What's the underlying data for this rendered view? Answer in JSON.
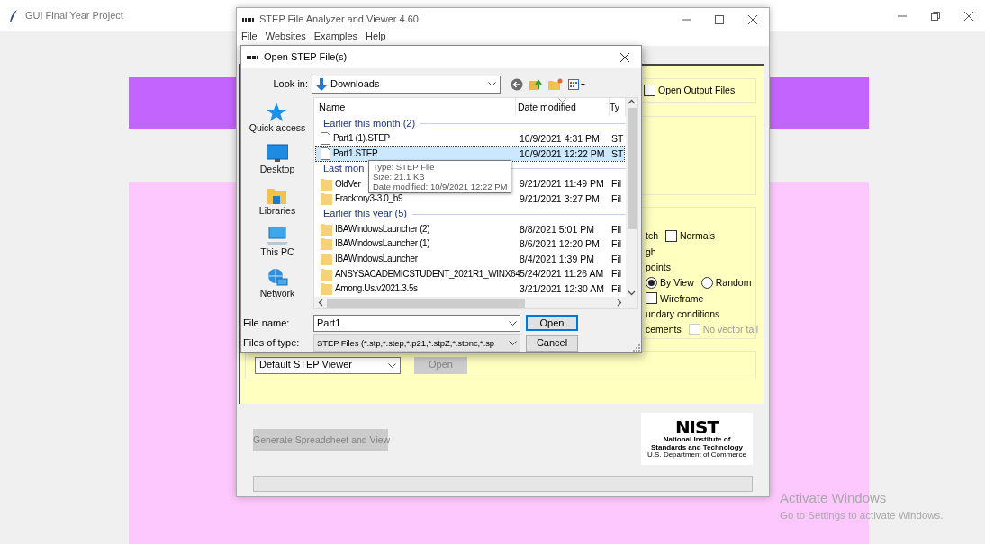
{
  "background_window": {
    "title": "GUI Final Year Project"
  },
  "step_window": {
    "title": "STEP File Analyzer and Viewer 4.60",
    "menu": [
      "File",
      "Websites",
      "Examples",
      "Help"
    ],
    "output_options": [
      {
        "kind": "checkbox",
        "label": "Open Output Files",
        "checked": false,
        "disabled": false
      }
    ],
    "view_options": [
      [
        {
          "kind": "text",
          "label": "tch"
        },
        {
          "kind": "checkbox",
          "label": "Normals",
          "checked": false,
          "disabled": false
        }
      ],
      [
        {
          "kind": "text",
          "label": "gh"
        }
      ],
      [
        {
          "kind": "text",
          "label": "points"
        }
      ],
      [
        {
          "kind": "radio",
          "label": "By View",
          "selected": true
        },
        {
          "kind": "radio",
          "label": "Random",
          "selected": false
        }
      ],
      [
        {
          "kind": "checkbox",
          "label": "Wireframe",
          "checked": false,
          "disabled": false
        }
      ],
      [
        {
          "kind": "text",
          "label": "undary conditions"
        }
      ],
      [
        {
          "kind": "text",
          "label": "cements"
        },
        {
          "kind": "checkbox",
          "label": "No vector tail",
          "checked": false,
          "disabled": true
        }
      ]
    ],
    "viewer": {
      "value": "Default STEP Viewer",
      "button": "Open",
      "disabled": true
    },
    "generate_button": {
      "label": "Generate Spreadsheet and View",
      "disabled": true
    },
    "logo": {
      "name": "NIST",
      "lines": [
        "National Institute of",
        "Standards and Technology",
        "U.S. Department of Commerce"
      ]
    },
    "progress": {
      "level": 0
    }
  },
  "dialog": {
    "title": "Open STEP File(s)",
    "look_in_label": "Look in:",
    "look_in": "Downloads",
    "places": [
      {
        "kind": "star",
        "label": "Quick access"
      },
      {
        "kind": "desktop",
        "label": "Desktop"
      },
      {
        "kind": "libraries",
        "label": "Libraries"
      },
      {
        "kind": "pc",
        "label": "This PC"
      },
      {
        "kind": "network",
        "label": "Network"
      }
    ],
    "columns": [
      "Name",
      "Date modified",
      "Ty"
    ],
    "groups": [
      {
        "label": "Earlier this month (2)",
        "files": [
          {
            "kind": "file",
            "name": "Part1 (1).STEP",
            "date": "10/9/2021 4:31 PM",
            "type": "ST",
            "selected": false
          },
          {
            "kind": "file",
            "name": "Part1.STEP",
            "date": "10/9/2021 12:22 PM",
            "type": "ST",
            "selected": true
          }
        ]
      },
      {
        "label": "Last mon",
        "files": [
          {
            "kind": "folder",
            "name": "OldVer",
            "date": "9/21/2021 11:49 PM",
            "type": "Fil",
            "selected": false
          },
          {
            "kind": "folder",
            "name": "Fracktory3-3.0_b9",
            "date": "9/21/2021 3:27 PM",
            "type": "Fil",
            "selected": false
          }
        ]
      },
      {
        "label": "Earlier this year (5)",
        "files": [
          {
            "kind": "folder",
            "name": "IBAWindowsLauncher (2)",
            "date": "8/8/2021 5:01 PM",
            "type": "Fil",
            "selected": false
          },
          {
            "kind": "folder",
            "name": "IBAWindowsLauncher (1)",
            "date": "8/6/2021 12:20 PM",
            "type": "Fil",
            "selected": false
          },
          {
            "kind": "folder",
            "name": "IBAWindowsLauncher",
            "date": "8/4/2021 1:39 PM",
            "type": "Fil",
            "selected": false
          },
          {
            "kind": "folder",
            "name": "ANSYSACADEMICSTUDENT_2021R1_WINX64",
            "date": "5/24/2021 11:26 AM",
            "type": "Fil",
            "selected": false
          },
          {
            "kind": "folder",
            "name": "Among.Us.v2021.3.5s",
            "date": "3/21/2021 12:30 AM",
            "type": "Fil",
            "selected": false
          }
        ]
      }
    ],
    "tooltip": [
      "Type: STEP File",
      "Size: 21.1 KB",
      "Date modified: 10/9/2021 12:22 PM"
    ],
    "file_name_label": "File name:",
    "file_name": "Part1",
    "file_type_label": "Files of type:",
    "file_type": "STEP Files (*.stp,*.step,*.p21,*.stpZ,*.stpnc,*.sp",
    "open_button": "Open",
    "cancel_button": "Cancel"
  },
  "activation_notice": {
    "title": "Activate Windows",
    "text": "Go to Settings to activate Windows."
  }
}
